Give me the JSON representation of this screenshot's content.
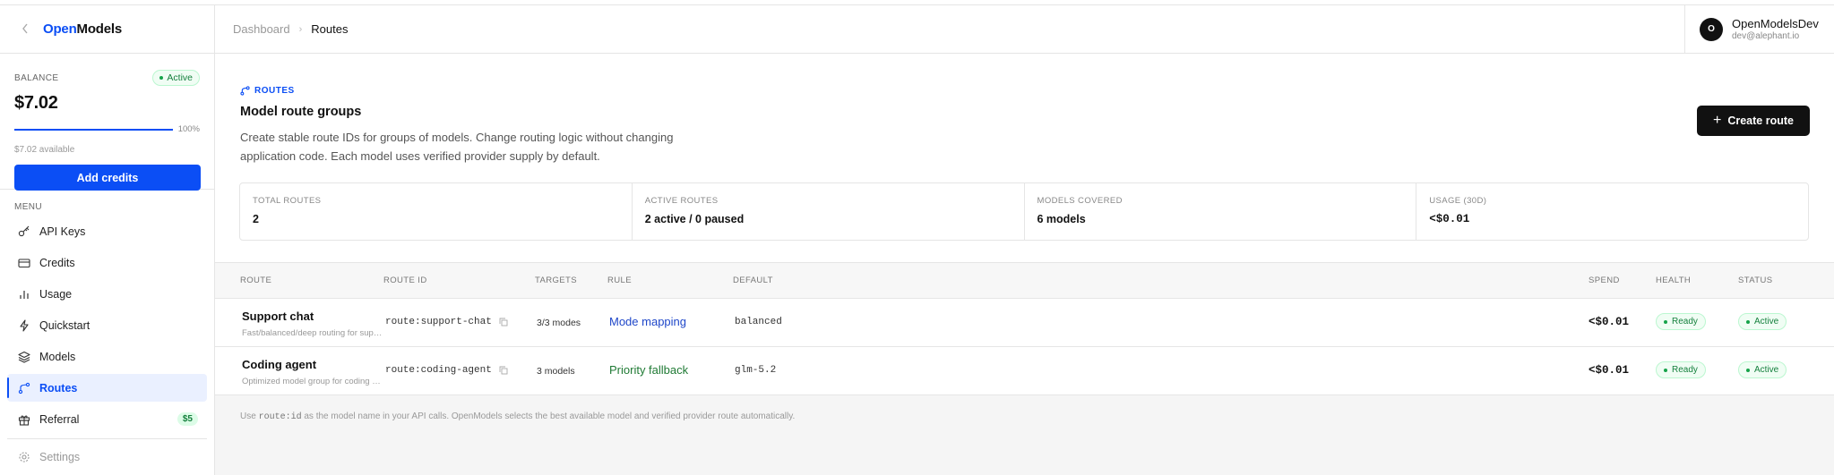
{
  "brand": {
    "part1": "Open",
    "part2": "Models"
  },
  "balance": {
    "label": "BALANCE",
    "status": "Active",
    "amount": "$7.02",
    "progress_percent": 100,
    "progress_label": "100%",
    "available": "$7.02 available",
    "add_credits": "Add credits"
  },
  "menu": {
    "label": "MENU",
    "items": [
      {
        "label": "API Keys",
        "icon": "key-icon"
      },
      {
        "label": "Credits",
        "icon": "credit-card-icon"
      },
      {
        "label": "Usage",
        "icon": "bar-chart-icon"
      },
      {
        "label": "Quickstart",
        "icon": "lightning-icon"
      },
      {
        "label": "Models",
        "icon": "layers-icon"
      },
      {
        "label": "Routes",
        "icon": "route-icon",
        "active": true
      },
      {
        "label": "Referral",
        "icon": "gift-icon",
        "badge": "$5"
      }
    ],
    "settings": "Settings"
  },
  "header": {
    "breadcrumb_root": "Dashboard",
    "breadcrumb_current": "Routes",
    "user_initial": "O",
    "user_name": "OpenModelsDev",
    "user_email": "dev@alephant.io"
  },
  "intro": {
    "tag": "ROUTES",
    "title": "Model route groups",
    "description": "Create stable route IDs for groups of models. Change routing logic without changing application code. Each model uses verified provider supply by default.",
    "create_button": "Create route"
  },
  "stats": [
    {
      "label": "TOTAL ROUTES",
      "value": "2"
    },
    {
      "label": "ACTIVE ROUTES",
      "value": "2 active / 0 paused"
    },
    {
      "label": "MODELS COVERED",
      "value": "6 models"
    },
    {
      "label": "USAGE (30D)",
      "value": "<$0.01"
    }
  ],
  "table": {
    "headers": {
      "route": "ROUTE",
      "route_id": "ROUTE ID",
      "targets": "TARGETS",
      "rule": "RULE",
      "default": "DEFAULT",
      "spend": "SPEND",
      "health": "HEALTH",
      "status": "STATUS"
    },
    "rows": [
      {
        "name": "Support chat",
        "subtitle": "Fast/balanced/deep routing for support",
        "route_id": "route:support-chat",
        "targets": "3/3 modes",
        "rule": "Mode mapping",
        "default": "balanced",
        "spend": "<$0.01",
        "health": "Ready",
        "status": "Active"
      },
      {
        "name": "Coding agent",
        "subtitle": "Optimized model group for coding agents",
        "route_id": "route:coding-agent",
        "targets": "3 models",
        "rule": "Priority fallback",
        "default": "glm-5.2",
        "spend": "<$0.01",
        "health": "Ready",
        "status": "Active"
      }
    ]
  },
  "footnote": {
    "pre": "Use ",
    "code": "route:id",
    "post": " as the model name in your API calls. OpenModels selects the best available model and verified provider route automatically."
  }
}
